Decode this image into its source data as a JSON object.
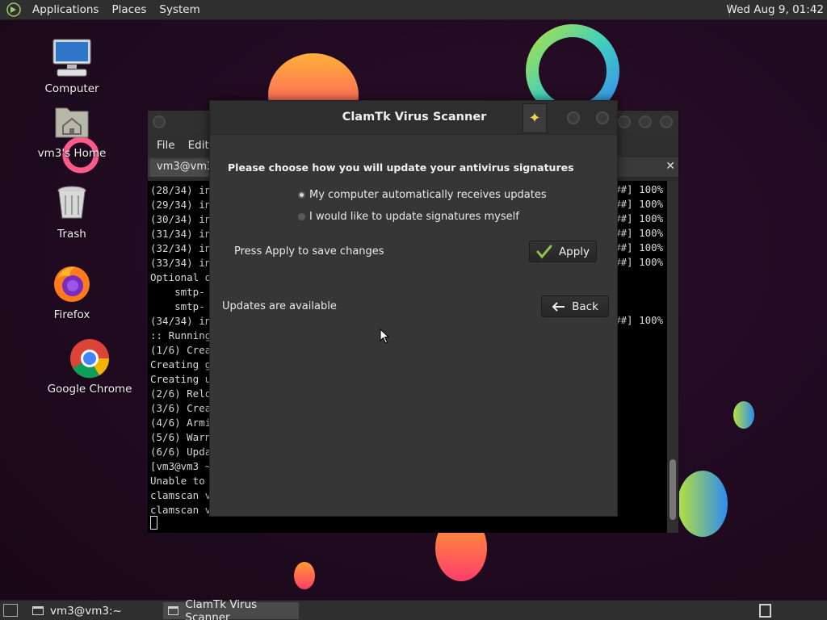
{
  "top_panel": {
    "menus": [
      "Applications",
      "Places",
      "System"
    ],
    "clock": "Wed Aug  9, 01:42"
  },
  "desktop_icons": [
    {
      "label": "Computer",
      "icon": "computer-icon"
    },
    {
      "label": "vm3's Home",
      "icon": "home-folder-icon"
    },
    {
      "label": "Trash",
      "icon": "trash-icon"
    },
    {
      "label": "Firefox",
      "icon": "firefox-icon"
    },
    {
      "label": "Google Chrome",
      "icon": "chrome-icon"
    }
  ],
  "terminal": {
    "menus": [
      "File",
      "Edit"
    ],
    "tab_title": "vm3@vm3",
    "lines": [
      "(28/34) in",
      "(29/34) in",
      "(30/34) in",
      "(31/34) in",
      "(32/34) in",
      "(33/34) in",
      "Optional d",
      "    smtp-",
      "    smtp-",
      "(34/34) in",
      ":: Running",
      "(1/6) Crea",
      "Creating g",
      "Creating u",
      "(2/6) Relo",
      "(3/6) Crea",
      "(4/6) Armi",
      "(5/6) Warn",
      "(6/6) Upda",
      "[vm3@vm3 ~",
      "Unable to",
      "clamscan v",
      "clamscan v"
    ],
    "progress_rows": [
      "##] 100%",
      "##] 100%",
      "##] 100%",
      "##] 100%",
      "##] 100%",
      "##] 100%",
      "##] 100%"
    ]
  },
  "dialog": {
    "title": "ClamTk Virus Scanner",
    "heading": "Please choose how you will update your antivirus signatures",
    "options": [
      {
        "label": "My computer automatically receives updates",
        "selected": true
      },
      {
        "label": "I would like to update signatures myself",
        "selected": false
      }
    ],
    "press_text": "Press Apply to save changes",
    "apply_label": "Apply",
    "back_label": "Back",
    "status": "Updates are available"
  },
  "taskbar": {
    "tasks": [
      {
        "label": "vm3@vm3:~",
        "active": false
      },
      {
        "label": "ClamTk Virus Scanner",
        "active": true
      }
    ]
  },
  "colors": {
    "desktop_bg": "#220b22",
    "panel": "#2f2f2f",
    "dialog_bg": "#363636",
    "apply_check": "#8bc34a",
    "star": "#f3d34a"
  }
}
